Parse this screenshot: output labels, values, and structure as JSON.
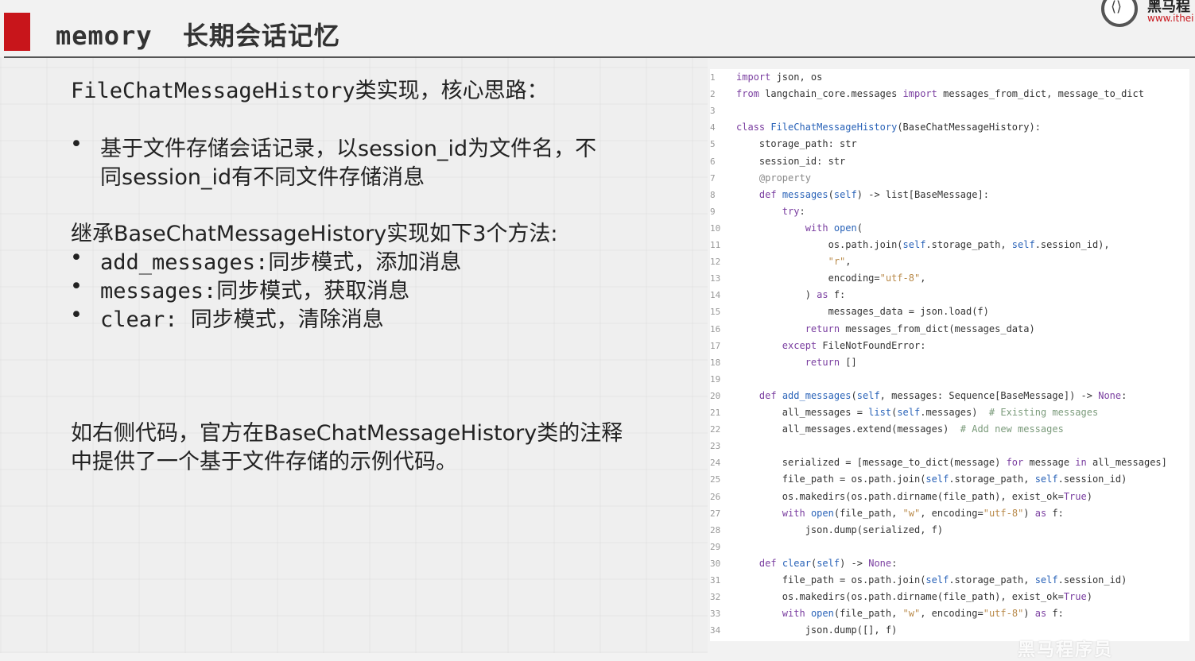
{
  "header": {
    "title_en": "memory",
    "title_cn": "长期会话记忆",
    "logo_cn": "黑马程",
    "logo_url": "www.ithei"
  },
  "left": {
    "intro": "FileChatMessageHistory类实现，核心思路：",
    "bullet1_line1": "基于文件存储会话记录，以session_id为文件名，不",
    "bullet1_line2": "同session_id有不同文件存储消息",
    "inherit": "继承BaseChatMessageHistory实现如下3个方法:",
    "methods": [
      "add_messages:同步模式，添加消息",
      "messages:同步模式，获取消息",
      "clear: 同步模式，清除消息"
    ],
    "note_line1": "如右侧代码，官方在BaseChatMessageHistory类的注释",
    "note_line2": "中提供了一个基于文件存储的示例代码。",
    "bullet_glyph": "•"
  },
  "code": {
    "lines": [
      {
        "n": "1",
        "text": "import json, os"
      },
      {
        "n": "2",
        "text": "from langchain_core.messages import messages_from_dict, message_to_dict"
      },
      {
        "n": "3",
        "text": ""
      },
      {
        "n": "4",
        "text": "class FileChatMessageHistory(BaseChatMessageHistory):"
      },
      {
        "n": "5",
        "text": "    storage_path: str"
      },
      {
        "n": "6",
        "text": "    session_id: str"
      },
      {
        "n": "7",
        "text": "    @property"
      },
      {
        "n": "8",
        "text": "    def messages(self) -> list[BaseMessage]:"
      },
      {
        "n": "9",
        "text": "        try:"
      },
      {
        "n": "10",
        "text": "            with open("
      },
      {
        "n": "11",
        "text": "                os.path.join(self.storage_path, self.session_id),"
      },
      {
        "n": "12",
        "text": "                \"r\","
      },
      {
        "n": "13",
        "text": "                encoding=\"utf-8\","
      },
      {
        "n": "14",
        "text": "            ) as f:"
      },
      {
        "n": "15",
        "text": "                messages_data = json.load(f)"
      },
      {
        "n": "16",
        "text": "            return messages_from_dict(messages_data)"
      },
      {
        "n": "17",
        "text": "        except FileNotFoundError:"
      },
      {
        "n": "18",
        "text": "            return []"
      },
      {
        "n": "19",
        "text": ""
      },
      {
        "n": "20",
        "text": "    def add_messages(self, messages: Sequence[BaseMessage]) -> None:"
      },
      {
        "n": "21",
        "text": "        all_messages = list(self.messages)  # Existing messages"
      },
      {
        "n": "22",
        "text": "        all_messages.extend(messages)  # Add new messages"
      },
      {
        "n": "23",
        "text": ""
      },
      {
        "n": "24",
        "text": "        serialized = [message_to_dict(message) for message in all_messages]"
      },
      {
        "n": "25",
        "text": "        file_path = os.path.join(self.storage_path, self.session_id)"
      },
      {
        "n": "26",
        "text": "        os.makedirs(os.path.dirname(file_path), exist_ok=True)"
      },
      {
        "n": "27",
        "text": "        with open(file_path, \"w\", encoding=\"utf-8\") as f:"
      },
      {
        "n": "28",
        "text": "            json.dump(serialized, f)"
      },
      {
        "n": "29",
        "text": ""
      },
      {
        "n": "30",
        "text": "    def clear(self) -> None:"
      },
      {
        "n": "31",
        "text": "        file_path = os.path.join(self.storage_path, self.session_id)"
      },
      {
        "n": "32",
        "text": "        os.makedirs(os.path.dirname(file_path), exist_ok=True)"
      },
      {
        "n": "33",
        "text": "        with open(file_path, \"w\", encoding=\"utf-8\") as f:"
      },
      {
        "n": "34",
        "text": "            json.dump([], f)"
      }
    ]
  },
  "watermark": "黑马程序员",
  "colors": {
    "accent_red": "#c8151b",
    "keyword": "#7a3ea0",
    "function": "#2a63b8",
    "string": "#b98a4a",
    "comment": "#7b9b7b"
  }
}
